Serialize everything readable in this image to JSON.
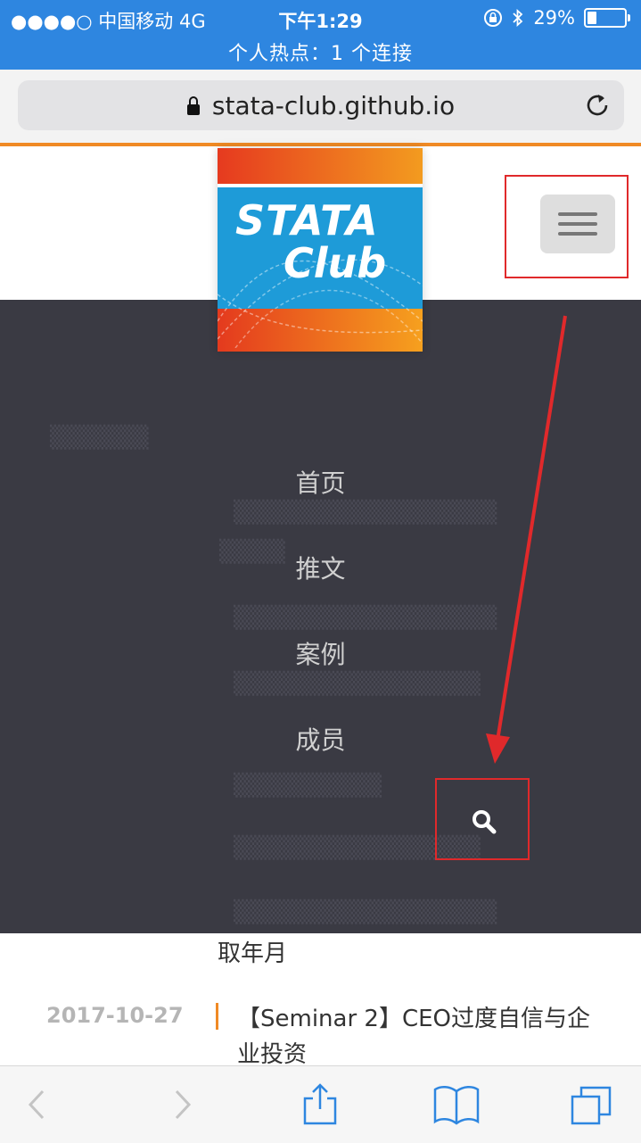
{
  "status_bar": {
    "carrier": "●●●●○ 中国移动   4G",
    "time": "下午1:29",
    "battery": "29%",
    "hotspot": "个人热点：1 个连接"
  },
  "address_bar": {
    "url": "stata-club.github.io"
  },
  "logo": {
    "line1": "STATA",
    "line2": "Club"
  },
  "menu": {
    "items": [
      "首页",
      "推文",
      "案例",
      "成员"
    ]
  },
  "content": {
    "continued_title": "取年月",
    "post": {
      "date": "2017-10-27",
      "title": "【Seminar 2】CEO过度自信与企业投资"
    }
  },
  "colors": {
    "status_bar": "#2e86e0",
    "accent": "#f08a24",
    "overlay": "#3a3a43",
    "annotation": "#e0292b"
  }
}
